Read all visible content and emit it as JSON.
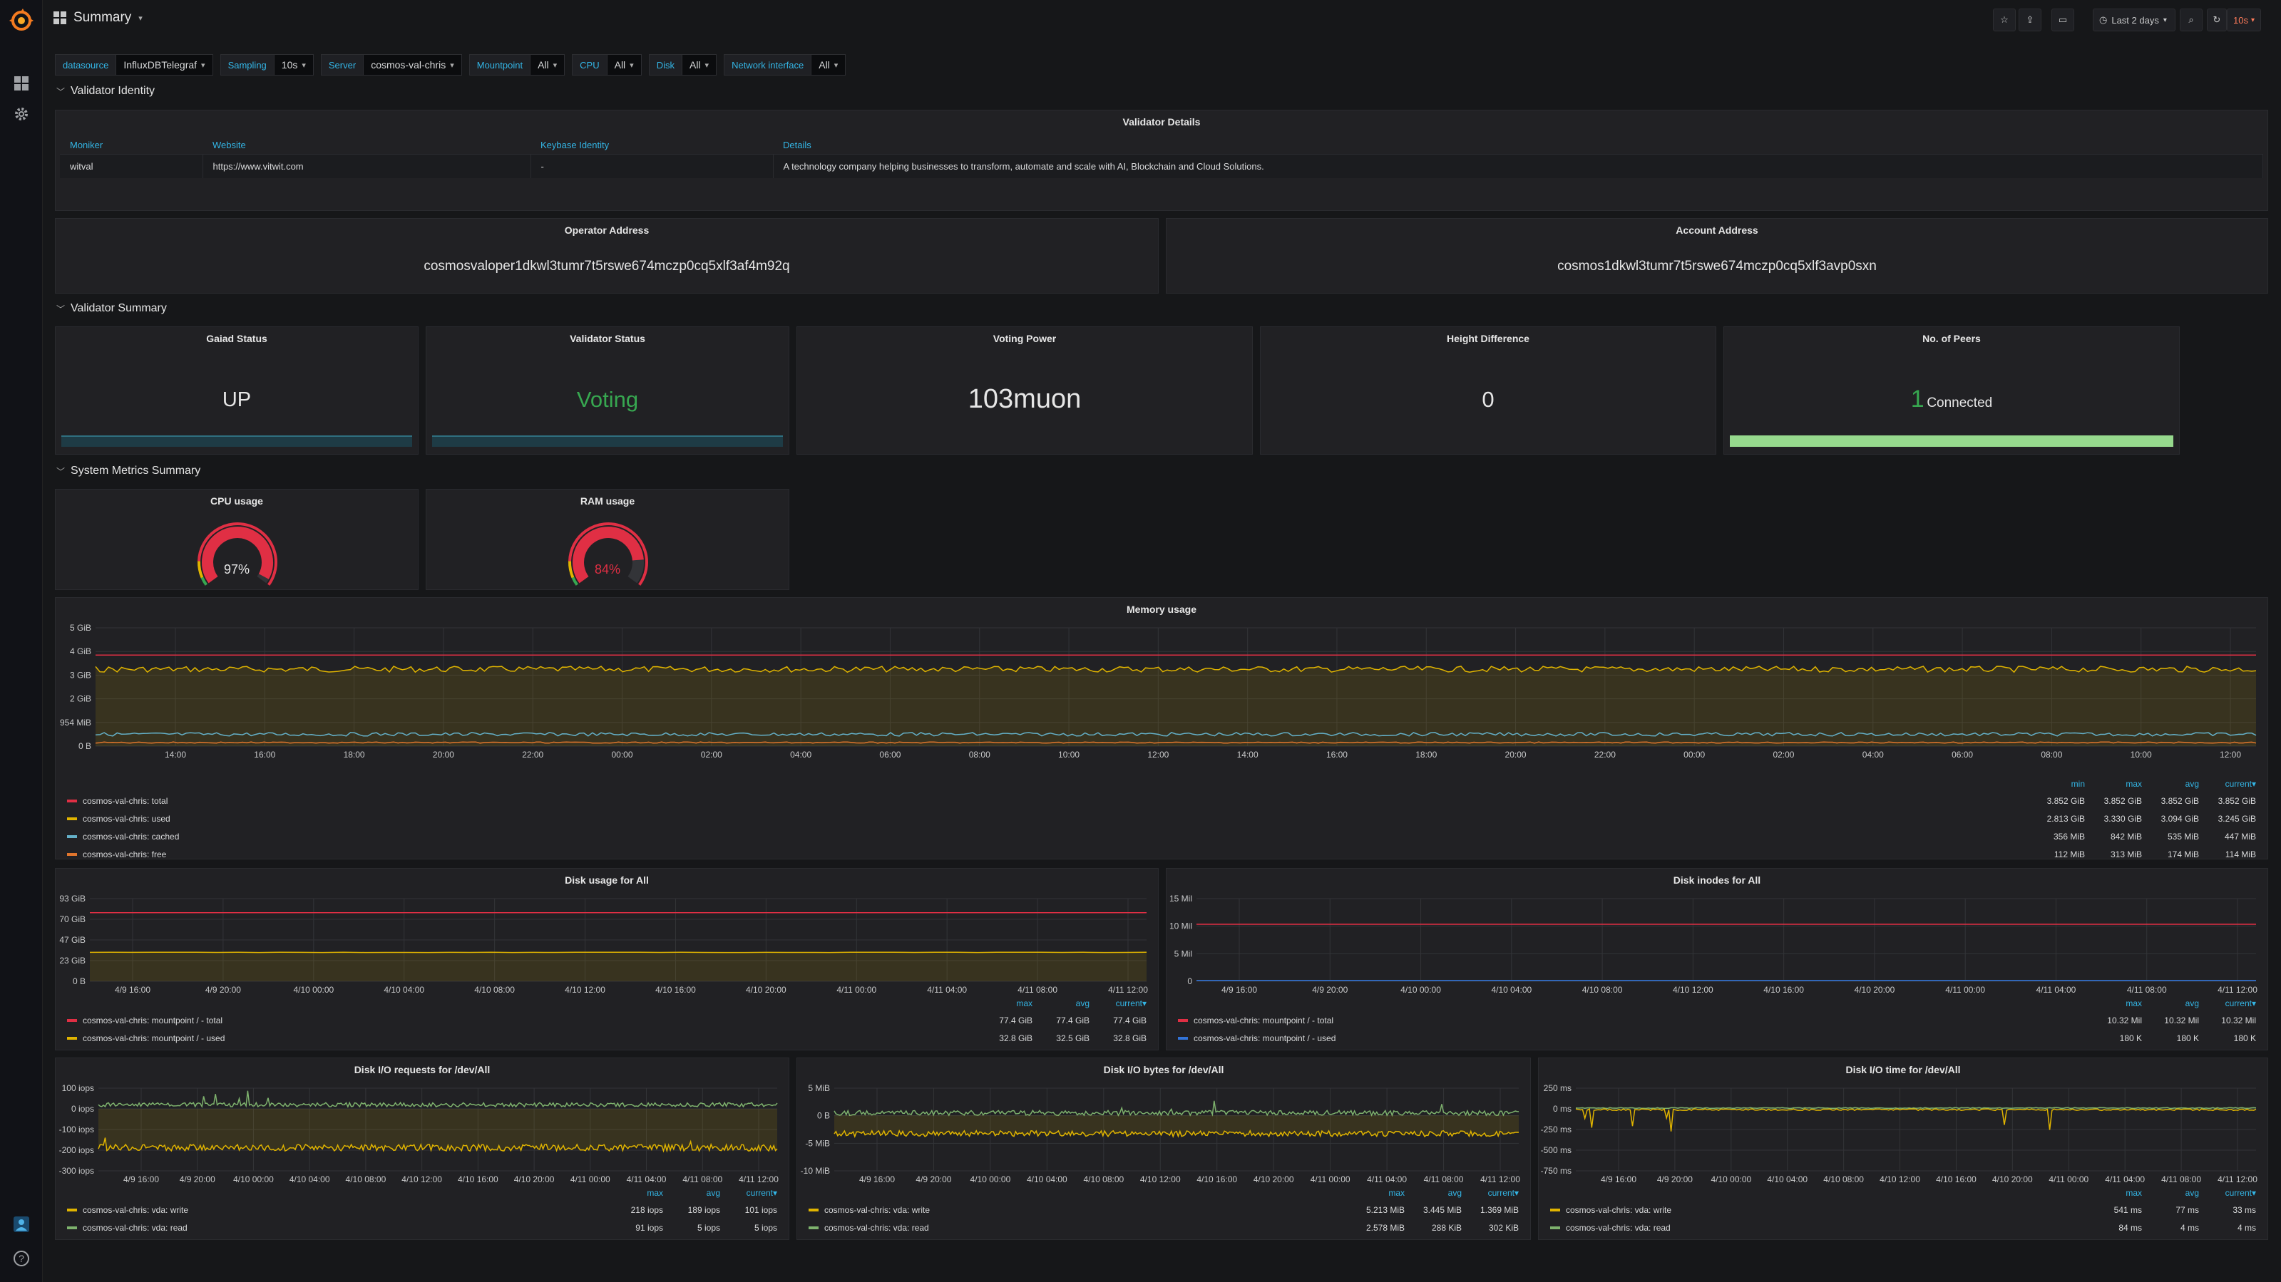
{
  "dashboard": {
    "title": "Summary"
  },
  "toolbar": {
    "time_range": "Last 2 days",
    "refresh": "10s"
  },
  "variables": [
    {
      "label": "datasource",
      "value": "InfluxDBTelegraf"
    },
    {
      "label": "Sampling",
      "value": "10s"
    },
    {
      "label": "Server",
      "value": "cosmos-val-chris"
    },
    {
      "label": "Mountpoint",
      "value": "All"
    },
    {
      "label": "CPU",
      "value": "All"
    },
    {
      "label": "Disk",
      "value": "All"
    },
    {
      "label": "Network interface",
      "value": "All"
    }
  ],
  "rows": {
    "identity": "Validator Identity",
    "summary": "Validator Summary",
    "metrics": "System Metrics Summary"
  },
  "validator_details": {
    "title": "Validator Details",
    "headers": [
      "Moniker",
      "Website",
      "Keybase Identity",
      "Details"
    ],
    "row": [
      "witval",
      "https://www.vitwit.com",
      "-",
      "A technology company helping businesses to transform, automate and scale with AI, Blockchain and Cloud Solutions."
    ]
  },
  "operator": {
    "title": "Operator Address",
    "value": "cosmosvaloper1dkwl3tumr7t5rswe674mczp0cq5xlf3af4m92q"
  },
  "account": {
    "title": "Account Address",
    "value": "cosmos1dkwl3tumr7t5rswe674mczp0cq5xlf3avp0sxn"
  },
  "stats": {
    "gaiad": {
      "title": "Gaiad Status",
      "value": "UP"
    },
    "validator": {
      "title": "Validator Status",
      "value": "Voting"
    },
    "voting_power": {
      "title": "Voting Power",
      "value": "103muon"
    },
    "height_diff": {
      "title": "Height Difference",
      "value": "0"
    },
    "peers": {
      "title": "No. of Peers",
      "value": "1",
      "suffix": "Connected"
    }
  },
  "gauges": {
    "cpu": {
      "title": "CPU usage",
      "value": "97%",
      "percent": 97
    },
    "ram": {
      "title": "RAM usage",
      "value": "84%",
      "percent": 84
    }
  },
  "memory": {
    "title": "Memory usage",
    "y_ticks": [
      "5 GiB",
      "4 GiB",
      "3 GiB",
      "2 GiB",
      "954 MiB",
      "0 B"
    ],
    "x_ticks": [
      "14:00",
      "16:00",
      "18:00",
      "20:00",
      "22:00",
      "00:00",
      "02:00",
      "04:00",
      "06:00",
      "08:00",
      "10:00",
      "12:00",
      "14:00",
      "16:00",
      "18:00",
      "20:00",
      "22:00",
      "00:00",
      "02:00",
      "04:00",
      "06:00",
      "08:00",
      "10:00",
      "12:00"
    ],
    "legend_headers": [
      "min",
      "max",
      "avg",
      "current▾"
    ],
    "legend": [
      {
        "name": "cosmos-val-chris: total",
        "color": "#e02f44",
        "vals": [
          "3.852 GiB",
          "3.852 GiB",
          "3.852 GiB",
          "3.852 GiB"
        ]
      },
      {
        "name": "cosmos-val-chris: used",
        "color": "#e0b400",
        "vals": [
          "2.813 GiB",
          "3.330 GiB",
          "3.094 GiB",
          "3.245 GiB"
        ]
      },
      {
        "name": "cosmos-val-chris: cached",
        "color": "#64b0c8",
        "vals": [
          "356 MiB",
          "842 MiB",
          "535 MiB",
          "447 MiB"
        ]
      },
      {
        "name": "cosmos-val-chris: free",
        "color": "#e0752d",
        "vals": [
          "112 MiB",
          "313 MiB",
          "174 MiB",
          "114 MiB"
        ]
      }
    ]
  },
  "disk_usage": {
    "title": "Disk usage for All",
    "y_ticks": [
      "93 GiB",
      "70 GiB",
      "47 GiB",
      "23 GiB",
      "0 B"
    ],
    "x_ticks": [
      "4/9 16:00",
      "4/9 20:00",
      "4/10 00:00",
      "4/10 04:00",
      "4/10 08:00",
      "4/10 12:00",
      "4/10 16:00",
      "4/10 20:00",
      "4/11 00:00",
      "4/11 04:00",
      "4/11 08:00",
      "4/11 12:00"
    ],
    "legend_headers": [
      "max",
      "avg",
      "current▾"
    ],
    "legend": [
      {
        "name": "cosmos-val-chris: mountpoint / - total",
        "color": "#e02f44",
        "vals": [
          "77.4 GiB",
          "77.4 GiB",
          "77.4 GiB"
        ]
      },
      {
        "name": "cosmos-val-chris: mountpoint / - used",
        "color": "#e0b400",
        "vals": [
          "32.8 GiB",
          "32.5 GiB",
          "32.8 GiB"
        ]
      }
    ]
  },
  "disk_inodes": {
    "title": "Disk inodes for All",
    "y_ticks": [
      "15 Mil",
      "10 Mil",
      "5 Mil",
      "0"
    ],
    "x_ticks": [
      "4/9 16:00",
      "4/9 20:00",
      "4/10 00:00",
      "4/10 04:00",
      "4/10 08:00",
      "4/10 12:00",
      "4/10 16:00",
      "4/10 20:00",
      "4/11 00:00",
      "4/11 04:00",
      "4/11 08:00",
      "4/11 12:00"
    ],
    "legend_headers": [
      "max",
      "avg",
      "current▾"
    ],
    "legend": [
      {
        "name": "cosmos-val-chris: mountpoint / - total",
        "color": "#e02f44",
        "vals": [
          "10.32 Mil",
          "10.32 Mil",
          "10.32 Mil"
        ]
      },
      {
        "name": "cosmos-val-chris: mountpoint / - used",
        "color": "#3274d9",
        "vals": [
          "180 K",
          "180 K",
          "180 K"
        ]
      }
    ]
  },
  "io_req": {
    "title": "Disk I/O requests for /dev/All",
    "y_ticks": [
      "100 iops",
      "0 iops",
      "-100 iops",
      "-200 iops",
      "-300 iops"
    ],
    "x_ticks": [
      "4/9 16:00",
      "4/9 20:00",
      "4/10 00:00",
      "4/10 04:00",
      "4/10 08:00",
      "4/10 12:00",
      "4/10 16:00",
      "4/10 20:00",
      "4/11 00:00",
      "4/11 04:00",
      "4/11 08:00",
      "4/11 12:00"
    ],
    "legend_headers": [
      "max",
      "avg",
      "current▾"
    ],
    "legend": [
      {
        "name": "cosmos-val-chris: vda: write",
        "color": "#e0b400",
        "vals": [
          "218 iops",
          "189 iops",
          "101 iops"
        ]
      },
      {
        "name": "cosmos-val-chris: vda: read",
        "color": "#7eb26d",
        "vals": [
          "91 iops",
          "5 iops",
          "5 iops"
        ]
      }
    ]
  },
  "io_bytes": {
    "title": "Disk I/O bytes for /dev/All",
    "y_ticks": [
      "5 MiB",
      "0 B",
      "-5 MiB",
      "-10 MiB"
    ],
    "x_ticks": [
      "4/9 16:00",
      "4/9 20:00",
      "4/10 00:00",
      "4/10 04:00",
      "4/10 08:00",
      "4/10 12:00",
      "4/10 16:00",
      "4/10 20:00",
      "4/11 00:00",
      "4/11 04:00",
      "4/11 08:00",
      "4/11 12:00"
    ],
    "legend_headers": [
      "max",
      "avg",
      "current▾"
    ],
    "legend": [
      {
        "name": "cosmos-val-chris: vda: write",
        "color": "#e0b400",
        "vals": [
          "5.213 MiB",
          "3.445 MiB",
          "1.369 MiB"
        ]
      },
      {
        "name": "cosmos-val-chris: vda: read",
        "color": "#7eb26d",
        "vals": [
          "2.578 MiB",
          "288 KiB",
          "302 KiB"
        ]
      }
    ]
  },
  "io_time": {
    "title": "Disk I/O time for /dev/All",
    "y_ticks": [
      "250 ms",
      "0 ms",
      "-250 ms",
      "-500 ms",
      "-750 ms"
    ],
    "x_ticks": [
      "4/9 16:00",
      "4/9 20:00",
      "4/10 00:00",
      "4/10 04:00",
      "4/10 08:00",
      "4/10 12:00",
      "4/10 16:00",
      "4/10 20:00",
      "4/11 00:00",
      "4/11 04:00",
      "4/11 08:00",
      "4/11 12:00"
    ],
    "legend_headers": [
      "max",
      "avg",
      "current▾"
    ],
    "legend": [
      {
        "name": "cosmos-val-chris: vda: write",
        "color": "#e0b400",
        "vals": [
          "541 ms",
          "77 ms",
          "33 ms"
        ]
      },
      {
        "name": "cosmos-val-chris: vda: read",
        "color": "#7eb26d",
        "vals": [
          "84 ms",
          "4 ms",
          "4 ms"
        ]
      }
    ]
  }
}
